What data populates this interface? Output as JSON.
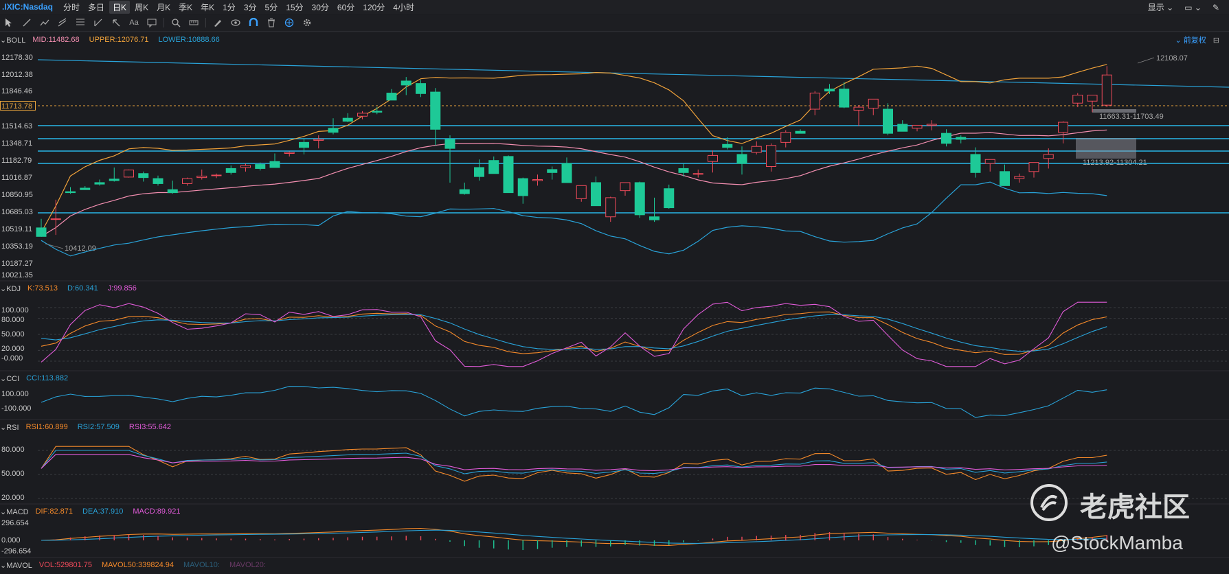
{
  "topbar": {
    "symbol": ".IXIC:Nasdaq",
    "periods": [
      "分时",
      "多日",
      "日K",
      "周K",
      "月K",
      "季K",
      "年K",
      "1分",
      "3分",
      "5分",
      "15分",
      "30分",
      "60分",
      "120分",
      "4小时"
    ],
    "active_period": "日K",
    "display_label": "显示",
    "adjust_label": "前复权"
  },
  "boll": {
    "name": "BOLL",
    "mid": "MID:11482.68",
    "upper": "UPPER:12076.71",
    "lower": "LOWER:10888.66",
    "colors": {
      "mid": "#f48fb1",
      "upper": "#f2a33a",
      "lower": "#29a3d9"
    }
  },
  "price_axis": [
    "12178.30",
    "12012.38",
    "11846.46",
    "11680.54",
    "11514.63",
    "11348.71",
    "11182.79",
    "11016.87",
    "10850.95",
    "10685.03",
    "10519.11",
    "10353.19",
    "10187.27",
    "10021.35"
  ],
  "current_price": "11713.78",
  "annotations": {
    "high": "12108.07",
    "low": "10412.09",
    "range1": "11663.31-11703.49",
    "range2": "11213.92-11304.21"
  },
  "kdj": {
    "name": "KDJ",
    "k": "K:73.513",
    "d": "D:60.341",
    "j": "J:99.856",
    "axis": [
      "100.000",
      "80.000",
      "50.000",
      "20.000",
      "-0.000"
    ]
  },
  "cci": {
    "name": "CCI",
    "value": "CCI:113.882",
    "axis": [
      "100.000",
      "-100.000"
    ]
  },
  "rsi": {
    "name": "RSI",
    "rsi1": "RSI1:60.899",
    "rsi2": "RSI2:57.509",
    "rsi3": "RSI3:55.642",
    "axis": [
      "80.000",
      "50.000",
      "20.000"
    ]
  },
  "macd": {
    "name": "MACD",
    "dif": "DIF:82.871",
    "dea": "DEA:37.910",
    "macd": "MACD:89.921",
    "axis": [
      "296.654",
      "0.000",
      "-296.654"
    ]
  },
  "mavol": {
    "name": "MAVOL",
    "vol": "VOL:529801.75",
    "mavol50": "MAVOL50:339824.94",
    "mavol10": "MAVOL10:",
    "mavol20": "MAVOL20:"
  },
  "watermark": {
    "brand": "老虎社区",
    "handle": "@StockMamba"
  },
  "chart_data": {
    "type": "candlestick",
    "candles_ohlc": [
      [
        10500,
        10590,
        10440,
        10415
      ],
      [
        10590,
        10780,
        10430,
        10590
      ],
      [
        10860,
        10905,
        10840,
        10850
      ],
      [
        10895,
        10915,
        10880,
        10880
      ],
      [
        10950,
        10980,
        10920,
        10935
      ],
      [
        10985,
        11100,
        10960,
        10970
      ],
      [
        11005,
        11080,
        11000,
        11075
      ],
      [
        11040,
        11060,
        10960,
        11000
      ],
      [
        10990,
        11020,
        10920,
        10940
      ],
      [
        10880,
        10970,
        10840,
        10850
      ],
      [
        10940,
        11000,
        10920,
        10990
      ],
      [
        11000,
        11080,
        10980,
        11015
      ],
      [
        11020,
        11040,
        10995,
        11025
      ],
      [
        11090,
        11120,
        11030,
        11050
      ],
      [
        11100,
        11140,
        11060,
        11120
      ],
      [
        11130,
        11150,
        11070,
        11090
      ],
      [
        11160,
        11240,
        11100,
        11100
      ],
      [
        11240,
        11260,
        11210,
        11250
      ],
      [
        11350,
        11390,
        11230,
        11300
      ],
      [
        11370,
        11420,
        11290,
        11380
      ],
      [
        11490,
        11590,
        11430,
        11450
      ],
      [
        11590,
        11640,
        11550,
        11560
      ],
      [
        11610,
        11660,
        11580,
        11640
      ],
      [
        11660,
        11700,
        11630,
        11650
      ],
      [
        11840,
        11880,
        11770,
        11770
      ],
      [
        11960,
        12000,
        11820,
        11920
      ],
      [
        11935,
        11970,
        11800,
        11835
      ],
      [
        11850,
        11890,
        11320,
        11480
      ],
      [
        11380,
        11420,
        10950,
        11290
      ],
      [
        10880,
        10950,
        10830,
        10840
      ],
      [
        11100,
        11180,
        10970,
        11010
      ],
      [
        11170,
        11210,
        11040,
        11040
      ],
      [
        11210,
        11220,
        10850,
        10850
      ],
      [
        10990,
        11000,
        10740,
        10820
      ],
      [
        10970,
        11030,
        10920,
        10980
      ],
      [
        11080,
        11110,
        10980,
        11050
      ],
      [
        11140,
        11200,
        10980,
        10950
      ],
      [
        10790,
        10890,
        10760,
        10920
      ],
      [
        10950,
        11010,
        10730,
        10720
      ],
      [
        10610,
        10810,
        10560,
        10800
      ],
      [
        10870,
        10940,
        10820,
        10950
      ],
      [
        10950,
        10960,
        10600,
        10630
      ],
      [
        10610,
        10800,
        10560,
        10580
      ],
      [
        10890,
        10930,
        10690,
        10700
      ],
      [
        11090,
        11140,
        11010,
        11050
      ],
      [
        11040,
        11080,
        11000,
        11040
      ],
      [
        11160,
        11270,
        11050,
        11220
      ],
      [
        11330,
        11400,
        11280,
        11300
      ],
      [
        11230,
        11310,
        11030,
        11140
      ],
      [
        11250,
        11360,
        11230,
        11310
      ],
      [
        11110,
        11340,
        11060,
        11320
      ],
      [
        11350,
        11470,
        11300,
        11450
      ],
      [
        11460,
        11480,
        11440,
        11440
      ],
      [
        11680,
        11860,
        11620,
        11840
      ],
      [
        11880,
        11930,
        11830,
        11860
      ],
      [
        11880,
        11950,
        11690,
        11700
      ],
      [
        11670,
        11720,
        11510,
        11700
      ],
      [
        11690,
        11740,
        11620,
        11780
      ],
      [
        11680,
        11740,
        11420,
        11440
      ],
      [
        11530,
        11570,
        11500,
        11460
      ],
      [
        11490,
        11520,
        11460,
        11520
      ],
      [
        11520,
        11570,
        11470,
        11530
      ],
      [
        11440,
        11480,
        11310,
        11340
      ],
      [
        11400,
        11420,
        11340,
        11380
      ],
      [
        11230,
        11300,
        11000,
        11050
      ],
      [
        11140,
        11160,
        11060,
        11180
      ],
      [
        11060,
        11130,
        10920,
        10920
      ],
      [
        10990,
        11040,
        10950,
        11010
      ],
      [
        11060,
        11100,
        11000,
        11150
      ],
      [
        11190,
        11290,
        11090,
        11230
      ],
      [
        11450,
        11560,
        11340,
        11550
      ],
      [
        11740,
        11840,
        11700,
        11820
      ],
      [
        11760,
        11790,
        11650,
        11820
      ],
      [
        11720,
        12108.07,
        11700,
        12020
      ]
    ],
    "boll_bands": {
      "mid": 11482.68,
      "upper": 12076.71,
      "lower": 10888.66
    },
    "kdj_last": {
      "K": 73.513,
      "D": 60.341,
      "J": 99.856
    },
    "cci_last": 113.882,
    "rsi_last": {
      "RSI1": 60.899,
      "RSI2": 57.509,
      "RSI3": 55.642
    },
    "macd_last": {
      "DIF": 82.871,
      "DEA": 37.91,
      "MACD": 89.921
    },
    "price_range": [
      10021.35,
      12178.3
    ]
  }
}
